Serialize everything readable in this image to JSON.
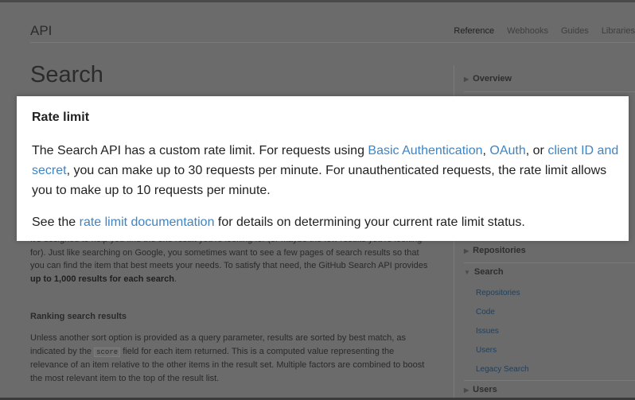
{
  "header": {
    "brand": "API",
    "nav": [
      "Reference",
      "Webhooks",
      "Guides",
      "Libraries"
    ]
  },
  "page": {
    "title": "Search",
    "intro_partial": "It's designed to help you find the one result you're looking for (or maybe the few results you're looking for). Just like searching on Google, you sometimes want to see a few pages of search results so that you can find the item that best meets your needs. To satisfy that need, the GitHub Search API provides",
    "intro_bold": "up to 1,000 results for each search",
    "intro_end": ".",
    "ranking_heading": "Ranking search results",
    "ranking_p_1": "Unless another sort option is provided as a query parameter, results are sorted by best match, as indicated by the",
    "ranking_code": "score",
    "ranking_p_2": "field for each item returned. This is a computed value representing the relevance of an item relative to the other items in the result set. Multiple factors are combined to boost the most relevant item to the top of the result list."
  },
  "sidebar": {
    "overview": "Overview",
    "repositories": "Repositories",
    "search": "Search",
    "search_items": [
      "Repositories",
      "Code",
      "Issues",
      "Users",
      "Legacy Search"
    ],
    "users": "Users"
  },
  "callout": {
    "heading": "Rate limit",
    "p1_a": "The Search API has a custom rate limit. For requests using ",
    "link_basic": "Basic Authentication",
    "p1_b": ", ",
    "link_oauth": "OAuth",
    "p1_c": ", or ",
    "link_client": "client ID and secret",
    "p1_d": ", you can make up to 30 requests per minute. For unauthenticated requests, the rate limit allows you to make up to 10 requests per minute.",
    "p2_a": "See the ",
    "link_ratelimit": "rate limit documentation",
    "p2_b": " for details on determining your current rate limit status."
  },
  "colors": {
    "link": "#3f84c4",
    "overlay": "#6b6b6b"
  }
}
